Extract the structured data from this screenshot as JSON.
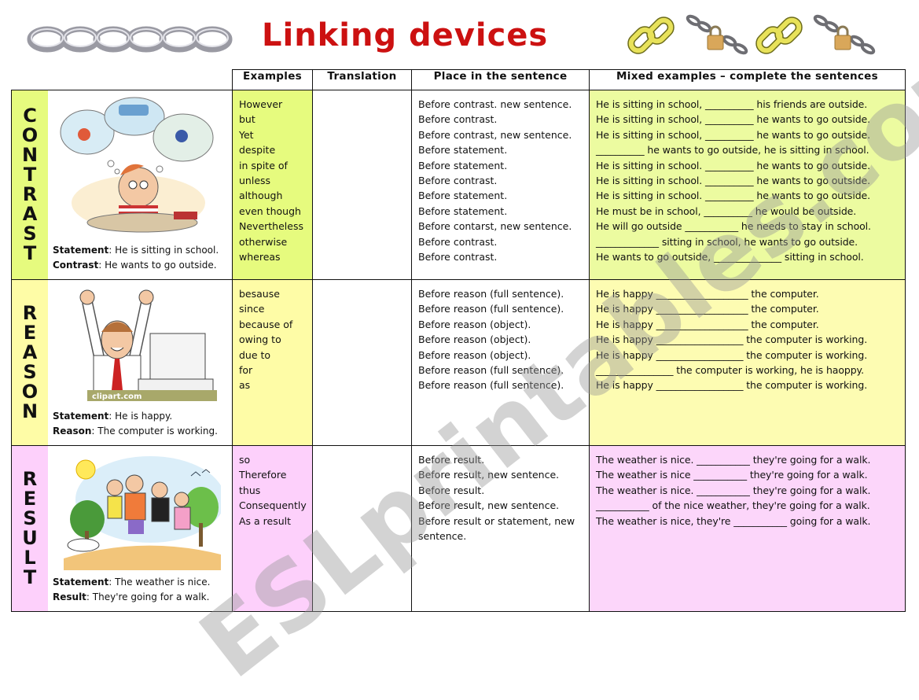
{
  "header": {
    "title": "Linking devices",
    "icons": [
      "chain-links-icon",
      "gold-chain-link-icon",
      "chain-padlock-icon",
      "gold-chain-link-icon",
      "chain-padlock-icon"
    ]
  },
  "columns": {
    "examples": "Examples",
    "translation": "Translation",
    "place": "Place in the sentence",
    "mixed": "Mixed examples – complete the sentences"
  },
  "colors": {
    "title": "#cc1111",
    "contrast": "#e6fb7e",
    "reason": "#fefca6",
    "result": "#fdd0fb"
  },
  "sections": {
    "contrast": {
      "label_letters": [
        "C",
        "O",
        "N",
        "T",
        "R",
        "A",
        "S",
        "T"
      ],
      "caption_1_key": "Statement",
      "caption_1_value": ": He is sitting in school.",
      "caption_2_key": "Contrast",
      "caption_2_value": ": He wants to go outside.",
      "examples": [
        "However",
        "but",
        "Yet",
        "despite",
        "in spite of",
        "unless",
        "although",
        "even though",
        "Nevertheless",
        "otherwise",
        "whereas"
      ],
      "places": [
        "Before contrast. new sentence.",
        "Before contrast.",
        "Before contrast, new sentence.",
        "Before statement.",
        "Before statement.",
        "Before contrast.",
        "Before statement.",
        "Before statement.",
        "Before contarst, new sentence.",
        "Before contrast.",
        "Before contrast."
      ],
      "mixed": [
        "He is sitting in school, __________ his friends are outside.",
        "He is sitting in school, __________ he wants to go outside.",
        "He is sitting in school, __________ he wants to go outside.",
        "__________ he wants to go outside, he is sitting in school.",
        "He is sitting in school. __________ he wants to go outside.",
        "He is sitting in school. __________ he wants to go outside.",
        "He is sitting in school. __________ he wants to go outside.",
        "He must be in school, __________ he would be outside.",
        "He will go outside ___________ he needs to stay in school.",
        "_____________ sitting in school, he wants to go outside.",
        "He wants to go outside, ______________ sitting in school."
      ]
    },
    "reason": {
      "label_letters": [
        "R",
        "E",
        "A",
        "S",
        "O",
        "N"
      ],
      "caption_1_key": "Statement",
      "caption_1_value": ": He is happy.",
      "caption_2_key": "Reason",
      "caption_2_value": ": The computer is working.",
      "image_credit": "clipart.com",
      "examples": [
        "besause",
        "since",
        "because of",
        "owing to",
        "due to",
        "for",
        "as"
      ],
      "places": [
        "Before reason (full sentence).",
        "Before reason (full sentence).",
        "Before reason (object).",
        "Before reason (object).",
        "Before reason (object).",
        "Before reason (full sentence).",
        "Before reason (full sentence)."
      ],
      "mixed": [
        "He is happy ___________________ the computer.",
        "He is happy ___________________ the computer.",
        "He is happy ___________________ the computer.",
        "He is happy __________________ the computer is working.",
        "He is happy __________________ the computer is working.",
        "________________ the computer is working, he is haoppy.",
        "He is happy __________________ the computer is working."
      ]
    },
    "result": {
      "label_letters": [
        "R",
        "E",
        "S",
        "U",
        "L",
        "T"
      ],
      "caption_1_key": "Statement",
      "caption_1_value": ": The weather is nice.",
      "caption_2_key": "Result",
      "caption_2_value": ": They're going for a walk.",
      "examples": [
        "so",
        "Therefore",
        "thus",
        "Consequently",
        "As a result"
      ],
      "places": [
        "Before result.",
        "Before result, new sentence.",
        "Before result.",
        "Before result, new sentence.",
        "Before result or statement, new",
        "sentence."
      ],
      "mixed": [
        "The weather is nice. ___________ they're going for a walk.",
        "The weather is nice ___________ they're going for a walk.",
        "The weather is nice. ___________ they're going for a walk.",
        "___________ of the nice weather, they're going for a walk.",
        "The weather is nice, they're ___________ going for a walk."
      ]
    }
  },
  "watermark": "ESLprintables.com"
}
